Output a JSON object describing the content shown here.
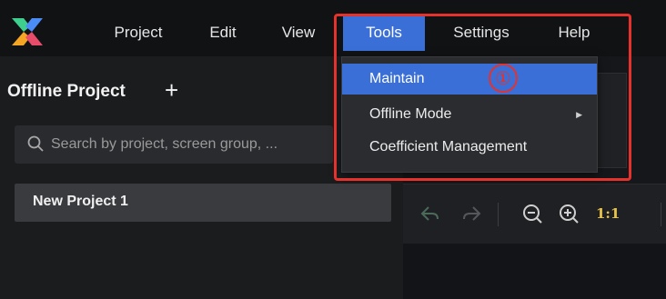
{
  "menubar": {
    "items": [
      {
        "label": "Project"
      },
      {
        "label": "Edit"
      },
      {
        "label": "View"
      },
      {
        "label": "Tools",
        "active": true
      },
      {
        "label": "Settings"
      },
      {
        "label": "Help"
      }
    ]
  },
  "tools_menu": {
    "items": [
      {
        "label": "Maintain",
        "highlighted": true
      },
      {
        "label": "Offline Mode",
        "has_submenu": true
      },
      {
        "label": "Coefficient Management"
      }
    ]
  },
  "left_panel": {
    "title": "Offline Project",
    "add_icon": "plus-icon",
    "search": {
      "placeholder": "Search by project, screen group, ..."
    },
    "projects": [
      {
        "label": "New Project 1"
      }
    ]
  },
  "toolbar": {
    "icons": [
      "undo-icon",
      "redo-icon",
      "zoom-out-icon",
      "zoom-in-icon"
    ],
    "ratio_label": "1:1"
  },
  "annotation": {
    "number": "①",
    "color": "#e5322c"
  },
  "colors": {
    "accent": "#3a6fd8",
    "menubar_bg": "#111214",
    "panel_bg": "#1b1c1e"
  }
}
